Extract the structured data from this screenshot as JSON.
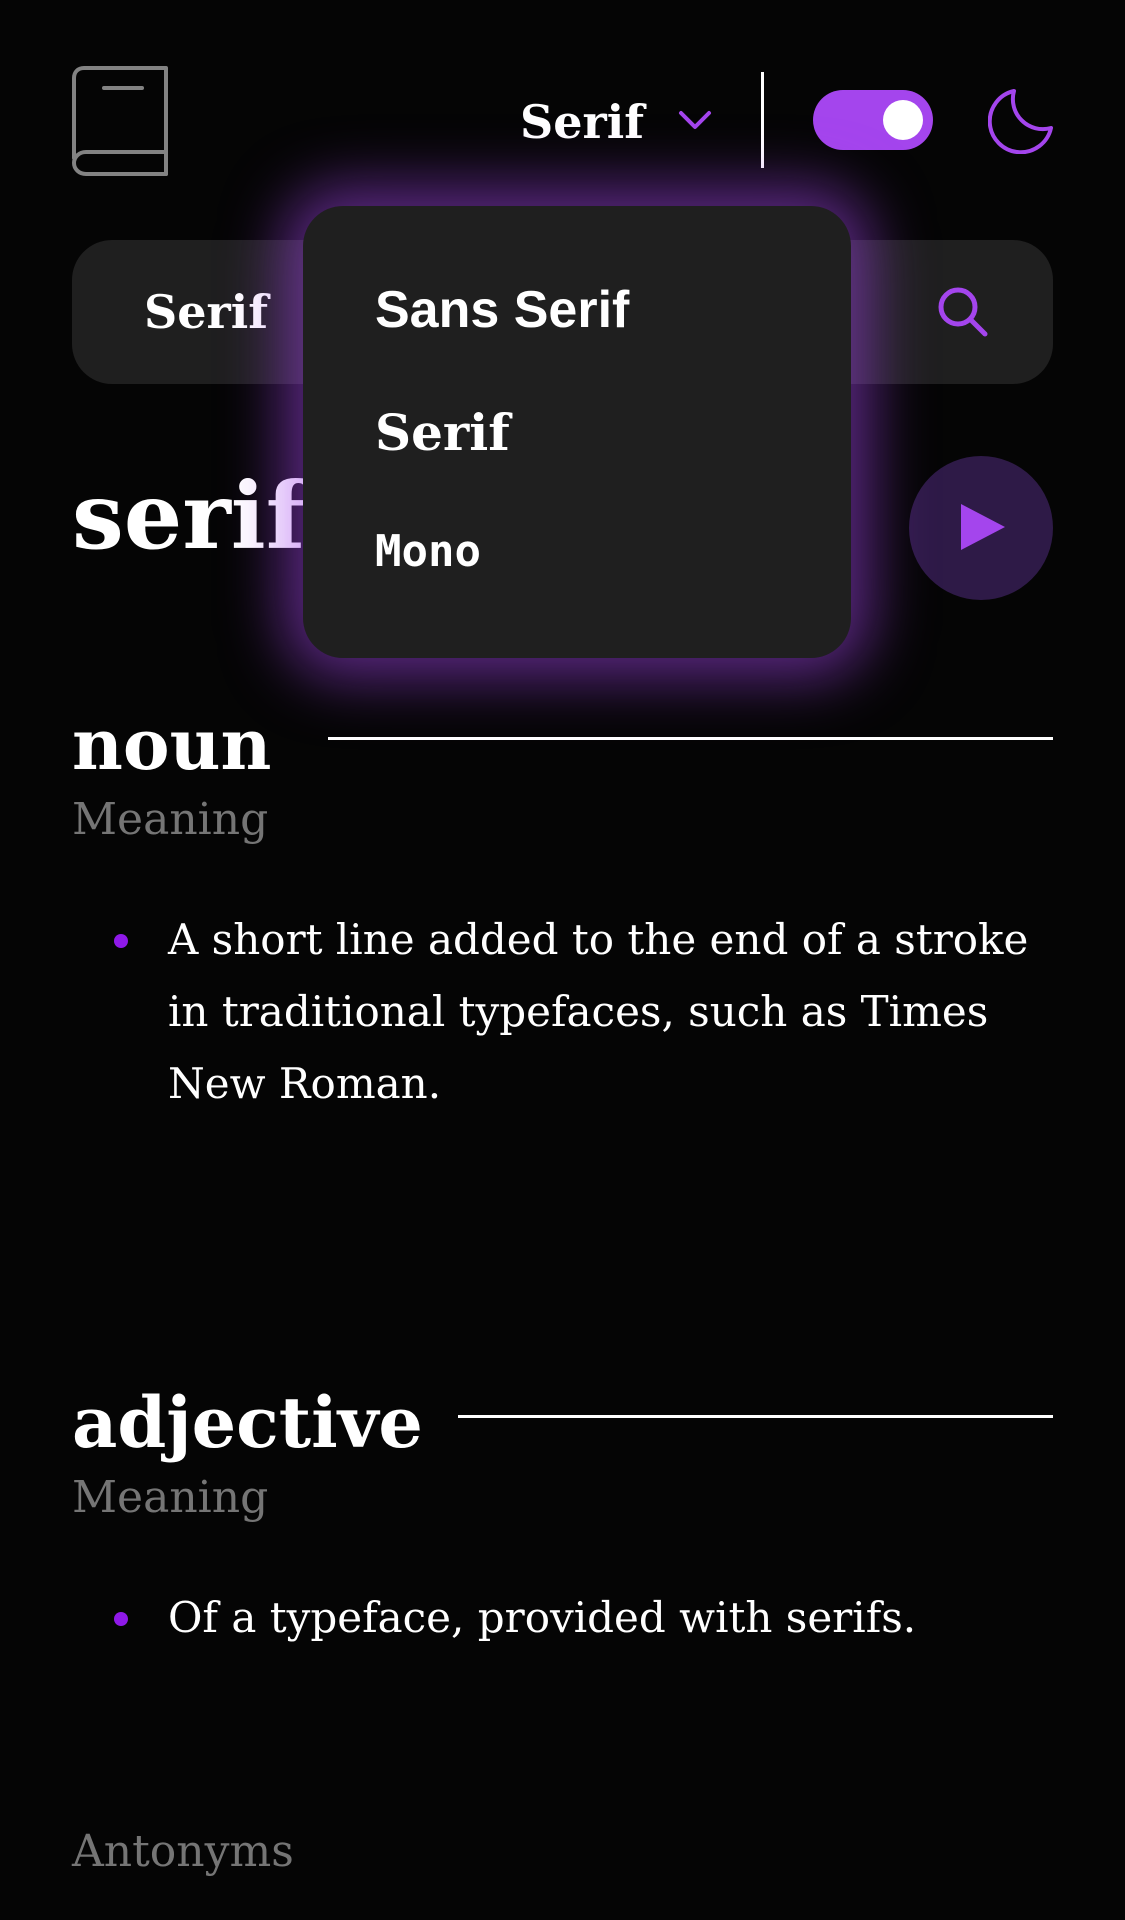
{
  "header": {
    "logo_icon": "book-icon",
    "font_selector_label": "Serif",
    "theme_icon": "moon-icon"
  },
  "search": {
    "value": "Serif",
    "icon": "search-icon"
  },
  "dropdown": {
    "options": [
      "Sans Serif",
      "Serif",
      "Mono"
    ]
  },
  "entry": {
    "word": "serif",
    "play_icon": "play-icon",
    "meanings": [
      {
        "part_of_speech": "noun",
        "meaning_label": "Meaning",
        "definitions": [
          "A short line added to the end of a stroke in traditional typefaces, such as Times New Roman."
        ]
      },
      {
        "part_of_speech": "adjective",
        "meaning_label": "Meaning",
        "definitions": [
          "Of a typeface, provided with serifs."
        ]
      }
    ],
    "antonyms_label": "Antonyms"
  },
  "colors": {
    "accent": "#a445ed",
    "background": "#050505",
    "surface": "#1f1f1f",
    "muted_text": "#757575"
  }
}
